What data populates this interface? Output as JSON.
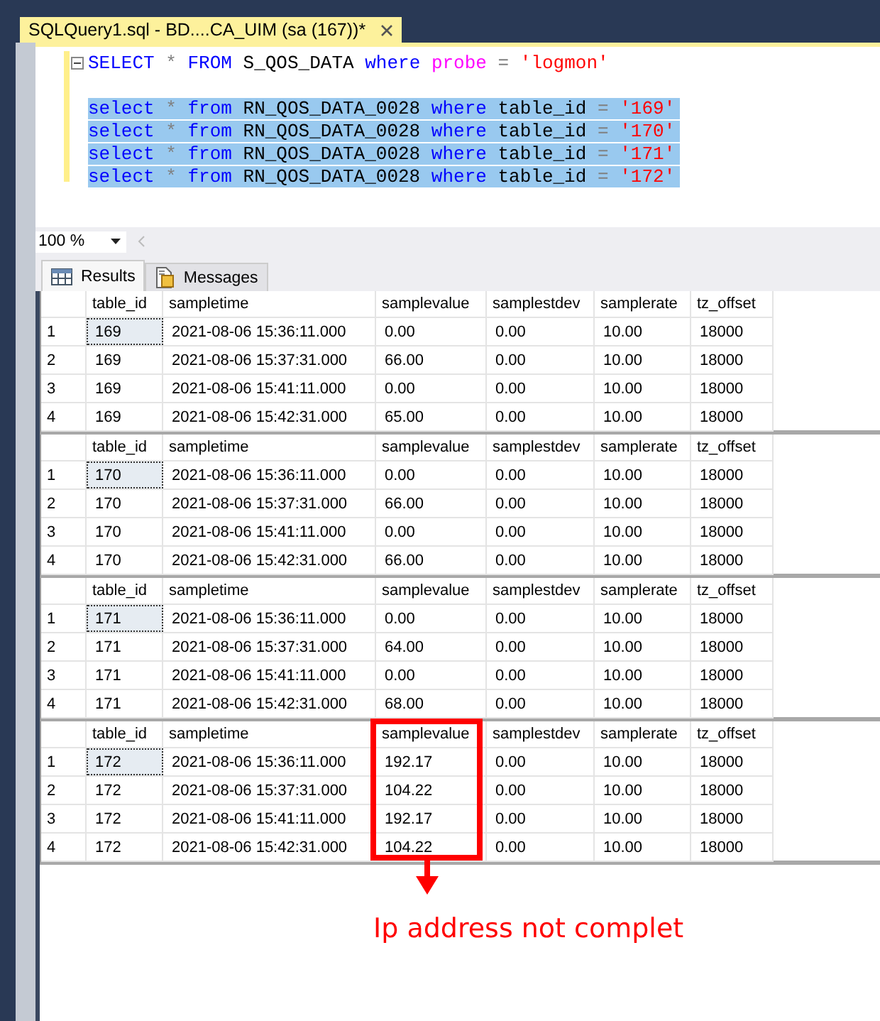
{
  "document_tab": {
    "title": "SQLQuery1.sql - BD....CA_UIM (sa (167))*",
    "selected": true
  },
  "editor": {
    "lines": [
      {
        "kind": "code",
        "selected": false,
        "tokens": [
          {
            "text": "SELECT",
            "kind": "keyword"
          },
          {
            "text": "*",
            "kind": "op"
          },
          {
            "text": "FROM",
            "kind": "keyword"
          },
          {
            "text": "S_QOS_DATA",
            "kind": "ident"
          },
          {
            "text": "where",
            "kind": "keyword"
          },
          {
            "text": "probe",
            "kind": "builtin"
          },
          {
            "text": "=",
            "kind": "op"
          },
          {
            "text": "'logmon'",
            "kind": "string"
          }
        ]
      },
      {
        "kind": "blank"
      },
      {
        "kind": "code",
        "selected": true,
        "tokens": [
          {
            "text": "select",
            "kind": "keyword"
          },
          {
            "text": "*",
            "kind": "op"
          },
          {
            "text": "from",
            "kind": "keyword"
          },
          {
            "text": "RN_QOS_DATA_0028",
            "kind": "ident"
          },
          {
            "text": "where",
            "kind": "keyword"
          },
          {
            "text": "table_id",
            "kind": "ident"
          },
          {
            "text": "=",
            "kind": "op"
          },
          {
            "text": "'169'",
            "kind": "string"
          }
        ]
      },
      {
        "kind": "code",
        "selected": true,
        "tokens": [
          {
            "text": "select",
            "kind": "keyword"
          },
          {
            "text": "*",
            "kind": "op"
          },
          {
            "text": "from",
            "kind": "keyword"
          },
          {
            "text": "RN_QOS_DATA_0028",
            "kind": "ident"
          },
          {
            "text": "where",
            "kind": "keyword"
          },
          {
            "text": "table_id",
            "kind": "ident"
          },
          {
            "text": "=",
            "kind": "op"
          },
          {
            "text": "'170'",
            "kind": "string"
          }
        ]
      },
      {
        "kind": "code",
        "selected": true,
        "tokens": [
          {
            "text": "select",
            "kind": "keyword"
          },
          {
            "text": "*",
            "kind": "op"
          },
          {
            "text": "from",
            "kind": "keyword"
          },
          {
            "text": "RN_QOS_DATA_0028",
            "kind": "ident"
          },
          {
            "text": "where",
            "kind": "keyword"
          },
          {
            "text": "table_id",
            "kind": "ident"
          },
          {
            "text": "=",
            "kind": "op"
          },
          {
            "text": "'171'",
            "kind": "string"
          }
        ]
      },
      {
        "kind": "code",
        "selected": true,
        "tokens": [
          {
            "text": "select",
            "kind": "keyword"
          },
          {
            "text": "*",
            "kind": "op"
          },
          {
            "text": "from",
            "kind": "keyword"
          },
          {
            "text": "RN_QOS_DATA_0028",
            "kind": "ident"
          },
          {
            "text": "where",
            "kind": "keyword"
          },
          {
            "text": "table_id",
            "kind": "ident"
          },
          {
            "text": "=",
            "kind": "op"
          },
          {
            "text": "'172'",
            "kind": "string"
          }
        ]
      }
    ]
  },
  "zoom": {
    "value": "100 %"
  },
  "result_tabs": [
    {
      "label": "Results",
      "selected": true
    },
    {
      "label": "Messages",
      "selected": false
    }
  ],
  "grids": [
    {
      "focus_cell": true,
      "columns": [
        {
          "label": "table_id",
          "highlighted": false
        },
        {
          "label": "sampletime",
          "highlighted": false
        },
        {
          "label": "samplevalue",
          "highlighted": false
        },
        {
          "label": "samplestdev",
          "highlighted": false
        },
        {
          "label": "samplerate",
          "highlighted": false
        },
        {
          "label": "tz_offset",
          "highlighted": false
        }
      ],
      "rows": [
        {
          "number": "1",
          "cells": [
            "169",
            "2021-08-06 15:36:11.000",
            "0.00",
            "0.00",
            "10.00",
            "18000"
          ]
        },
        {
          "number": "2",
          "cells": [
            "169",
            "2021-08-06 15:37:31.000",
            "66.00",
            "0.00",
            "10.00",
            "18000"
          ]
        },
        {
          "number": "3",
          "cells": [
            "169",
            "2021-08-06 15:41:11.000",
            "0.00",
            "0.00",
            "10.00",
            "18000"
          ]
        },
        {
          "number": "4",
          "cells": [
            "169",
            "2021-08-06 15:42:31.000",
            "65.00",
            "0.00",
            "10.00",
            "18000"
          ]
        }
      ]
    },
    {
      "focus_cell": true,
      "columns": [
        {
          "label": "table_id",
          "highlighted": false
        },
        {
          "label": "sampletime",
          "highlighted": false
        },
        {
          "label": "samplevalue",
          "highlighted": false
        },
        {
          "label": "samplestdev",
          "highlighted": false
        },
        {
          "label": "samplerate",
          "highlighted": false
        },
        {
          "label": "tz_offset",
          "highlighted": false
        }
      ],
      "rows": [
        {
          "number": "1",
          "cells": [
            "170",
            "2021-08-06 15:36:11.000",
            "0.00",
            "0.00",
            "10.00",
            "18000"
          ]
        },
        {
          "number": "2",
          "cells": [
            "170",
            "2021-08-06 15:37:31.000",
            "66.00",
            "0.00",
            "10.00",
            "18000"
          ]
        },
        {
          "number": "3",
          "cells": [
            "170",
            "2021-08-06 15:41:11.000",
            "0.00",
            "0.00",
            "10.00",
            "18000"
          ]
        },
        {
          "number": "4",
          "cells": [
            "170",
            "2021-08-06 15:42:31.000",
            "66.00",
            "0.00",
            "10.00",
            "18000"
          ]
        }
      ]
    },
    {
      "focus_cell": true,
      "columns": [
        {
          "label": "table_id",
          "highlighted": false
        },
        {
          "label": "sampletime",
          "highlighted": false
        },
        {
          "label": "samplevalue",
          "highlighted": false
        },
        {
          "label": "samplestdev",
          "highlighted": false
        },
        {
          "label": "samplerate",
          "highlighted": false
        },
        {
          "label": "tz_offset",
          "highlighted": false
        }
      ],
      "rows": [
        {
          "number": "1",
          "cells": [
            "171",
            "2021-08-06 15:36:11.000",
            "0.00",
            "0.00",
            "10.00",
            "18000"
          ]
        },
        {
          "number": "2",
          "cells": [
            "171",
            "2021-08-06 15:37:31.000",
            "64.00",
            "0.00",
            "10.00",
            "18000"
          ]
        },
        {
          "number": "3",
          "cells": [
            "171",
            "2021-08-06 15:41:11.000",
            "0.00",
            "0.00",
            "10.00",
            "18000"
          ]
        },
        {
          "number": "4",
          "cells": [
            "171",
            "2021-08-06 15:42:31.000",
            "68.00",
            "0.00",
            "10.00",
            "18000"
          ]
        }
      ]
    },
    {
      "focus_cell": true,
      "columns": [
        {
          "label": "table_id",
          "highlighted": false
        },
        {
          "label": "sampletime",
          "highlighted": false
        },
        {
          "label": "samplevalue",
          "highlighted": true
        },
        {
          "label": "samplestdev",
          "highlighted": false
        },
        {
          "label": "samplerate",
          "highlighted": false
        },
        {
          "label": "tz_offset",
          "highlighted": false
        }
      ],
      "rows": [
        {
          "number": "1",
          "cells": [
            "172",
            "2021-08-06 15:36:11.000",
            "192.17",
            "0.00",
            "10.00",
            "18000"
          ]
        },
        {
          "number": "2",
          "cells": [
            "172",
            "2021-08-06 15:37:31.000",
            "104.22",
            "0.00",
            "10.00",
            "18000"
          ]
        },
        {
          "number": "3",
          "cells": [
            "172",
            "2021-08-06 15:41:11.000",
            "192.17",
            "0.00",
            "10.00",
            "18000"
          ]
        },
        {
          "number": "4",
          "cells": [
            "172",
            "2021-08-06 15:42:31.000",
            "104.22",
            "0.00",
            "10.00",
            "18000"
          ]
        }
      ]
    }
  ],
  "annotation": {
    "text": "Ip address not complet"
  }
}
